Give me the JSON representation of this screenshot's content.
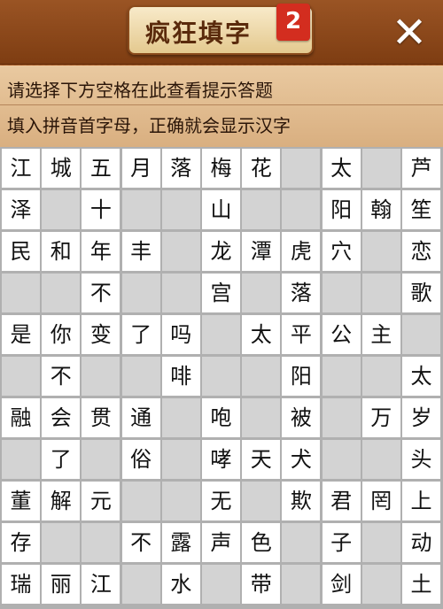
{
  "header": {
    "title": "疯狂填字",
    "badge": "2",
    "close_icon": "close-icon"
  },
  "hint": {
    "line1": "请选择下方空格在此查看提示答题",
    "line2": "填入拼音首字母，正确就会显示汉字"
  },
  "grid": {
    "cols": 11,
    "rows": 11,
    "cells": [
      [
        "江",
        "城",
        "五",
        "月",
        "落",
        "梅",
        "花",
        null,
        "太",
        null,
        "芦"
      ],
      [
        "泽",
        null,
        "十",
        null,
        null,
        "山",
        null,
        null,
        "阳",
        "翰",
        "笙"
      ],
      [
        "民",
        "和",
        "年",
        "丰",
        null,
        "龙",
        "潭",
        "虎",
        "穴",
        null,
        "恋"
      ],
      [
        null,
        null,
        "不",
        null,
        null,
        "宫",
        null,
        "落",
        null,
        null,
        "歌"
      ],
      [
        "是",
        "你",
        "变",
        "了",
        "吗",
        null,
        "太",
        "平",
        "公",
        "主",
        null
      ],
      [
        null,
        "不",
        null,
        null,
        "啡",
        null,
        null,
        "阳",
        null,
        null,
        "太"
      ],
      [
        "融",
        "会",
        "贯",
        "通",
        null,
        "咆",
        null,
        "被",
        null,
        "万",
        "岁"
      ],
      [
        null,
        "了",
        null,
        "俗",
        null,
        "哮",
        "天",
        "犬",
        null,
        null,
        "头"
      ],
      [
        "董",
        "解",
        "元",
        null,
        null,
        "无",
        null,
        "欺",
        "君",
        "罔",
        "上"
      ],
      [
        "存",
        null,
        null,
        "不",
        "露",
        "声",
        "色",
        null,
        "子",
        null,
        "动"
      ],
      [
        "瑞",
        "丽",
        "江",
        null,
        "水",
        null,
        "带",
        null,
        "剑",
        null,
        "土"
      ]
    ]
  }
}
